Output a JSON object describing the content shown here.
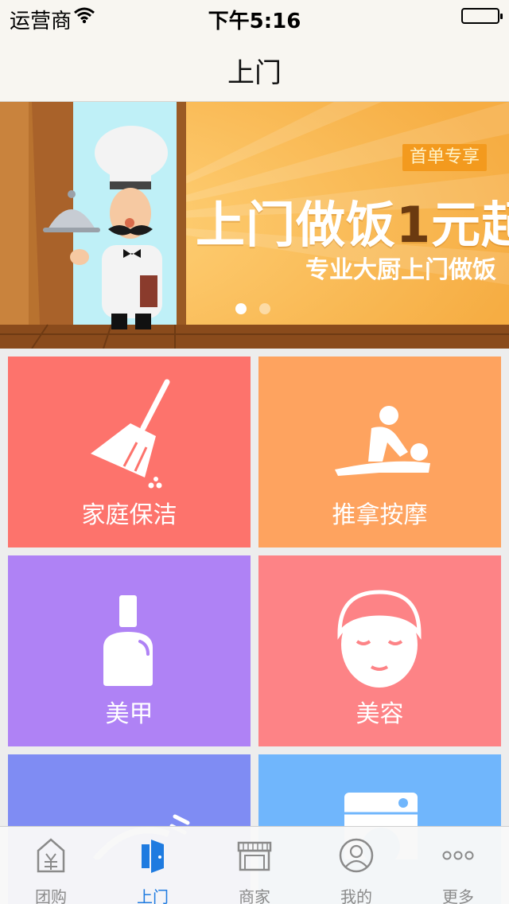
{
  "status_bar": {
    "carrier": "运营商",
    "time": "下午5:16"
  },
  "nav": {
    "title": "上门"
  },
  "banner": {
    "badge": "首单专享",
    "headline_main": "上门做饭",
    "headline_accent": "1",
    "headline_tail": "元起",
    "subline": "专业大厨上门做饭",
    "page_count": 2,
    "active_page": 1
  },
  "services": [
    {
      "label": "家庭保洁",
      "icon": "broom-icon",
      "color": "#fd736c"
    },
    {
      "label": "推拿按摩",
      "icon": "massage-icon",
      "color": "#fea35f"
    },
    {
      "label": "美甲",
      "icon": "nail-polish-icon",
      "color": "#af82f5"
    },
    {
      "label": "美容",
      "icon": "facial-icon",
      "color": "#fd8386"
    },
    {
      "label": "",
      "icon": "wash-icon",
      "color": "#7f8cf3"
    },
    {
      "label": "",
      "icon": "washing-machine-icon",
      "color": "#70b6fc"
    }
  ],
  "tabs": [
    {
      "label": "团购",
      "icon": "group-buy-icon",
      "active": false
    },
    {
      "label": "上门",
      "icon": "door-icon",
      "active": true
    },
    {
      "label": "商家",
      "icon": "store-icon",
      "active": false
    },
    {
      "label": "我的",
      "icon": "profile-icon",
      "active": false
    },
    {
      "label": "更多",
      "icon": "more-icon",
      "active": false
    }
  ],
  "colors": {
    "tab_active": "#1f7be0",
    "tab_inactive": "#8a8a8a",
    "banner_bg": "#f6b24a"
  }
}
